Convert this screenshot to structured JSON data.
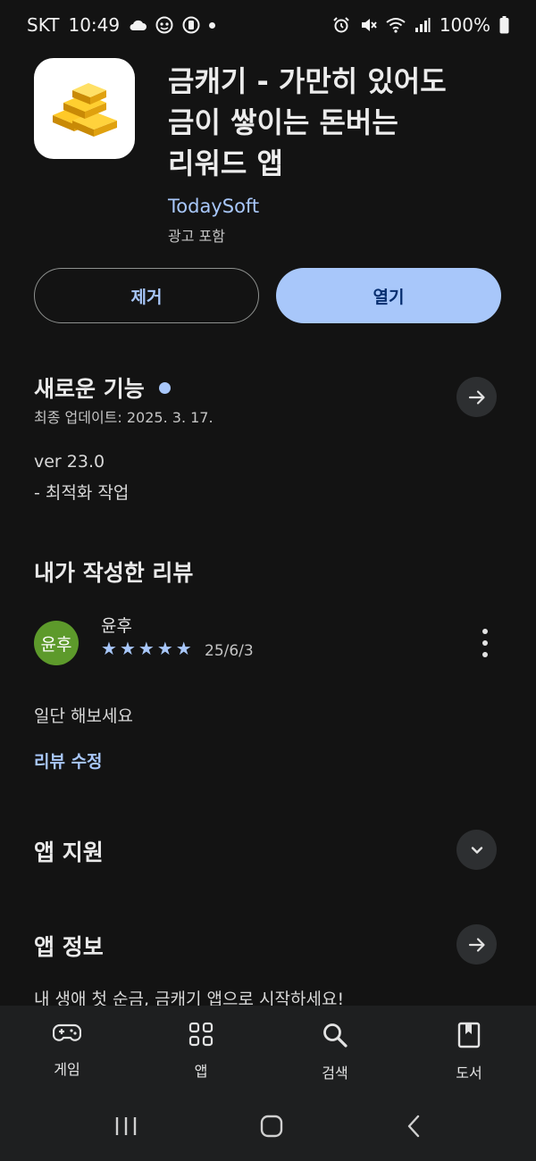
{
  "status_bar": {
    "carrier": "SKT",
    "time": "10:49",
    "battery": "100%",
    "icons": [
      "cloud-icon",
      "face-icon",
      "notification-icon",
      "alarm-icon",
      "mute-icon",
      "wifi-icon",
      "signal-icon",
      "battery-icon"
    ]
  },
  "app": {
    "title_lines": [
      "금캐기 - 가만히 있어도",
      "금이 쌓이는 돈버는",
      "리워드 앱"
    ],
    "developer": "TodaySoft",
    "ads_note": "광고 포함",
    "icon": "gold-bars-icon"
  },
  "actions": {
    "remove_label": "제거",
    "open_label": "열기"
  },
  "whats_new": {
    "title": "새로운 기능",
    "last_updated": "최종 업데이트: 2025. 3. 17.",
    "version": "ver 23.0",
    "notes": "- 최적화 작업"
  },
  "my_review": {
    "title": "내가 작성한 리뷰",
    "avatar_text": "윤후",
    "reviewer": "윤후",
    "rating": 5,
    "date": "25/6/3",
    "text": "일단 해보세요",
    "edit_label": "리뷰 수정"
  },
  "app_support": {
    "title": "앱 지원"
  },
  "app_info": {
    "title": "앱 정보",
    "description": "내 생애 첫 순금, 금캐기 앱으로 시작하세요!"
  },
  "bottom_nav": {
    "items": [
      {
        "label": "게임",
        "icon": "gamepad-icon"
      },
      {
        "label": "앱",
        "icon": "apps-grid-icon"
      },
      {
        "label": "검색",
        "icon": "search-icon"
      },
      {
        "label": "도서",
        "icon": "book-icon"
      }
    ]
  },
  "colors": {
    "background": "#131313",
    "accent": "#a8c7fa",
    "open_button_text": "#062e6f",
    "avatar": "#5d9a2b",
    "nav_background": "#1e1f20"
  }
}
